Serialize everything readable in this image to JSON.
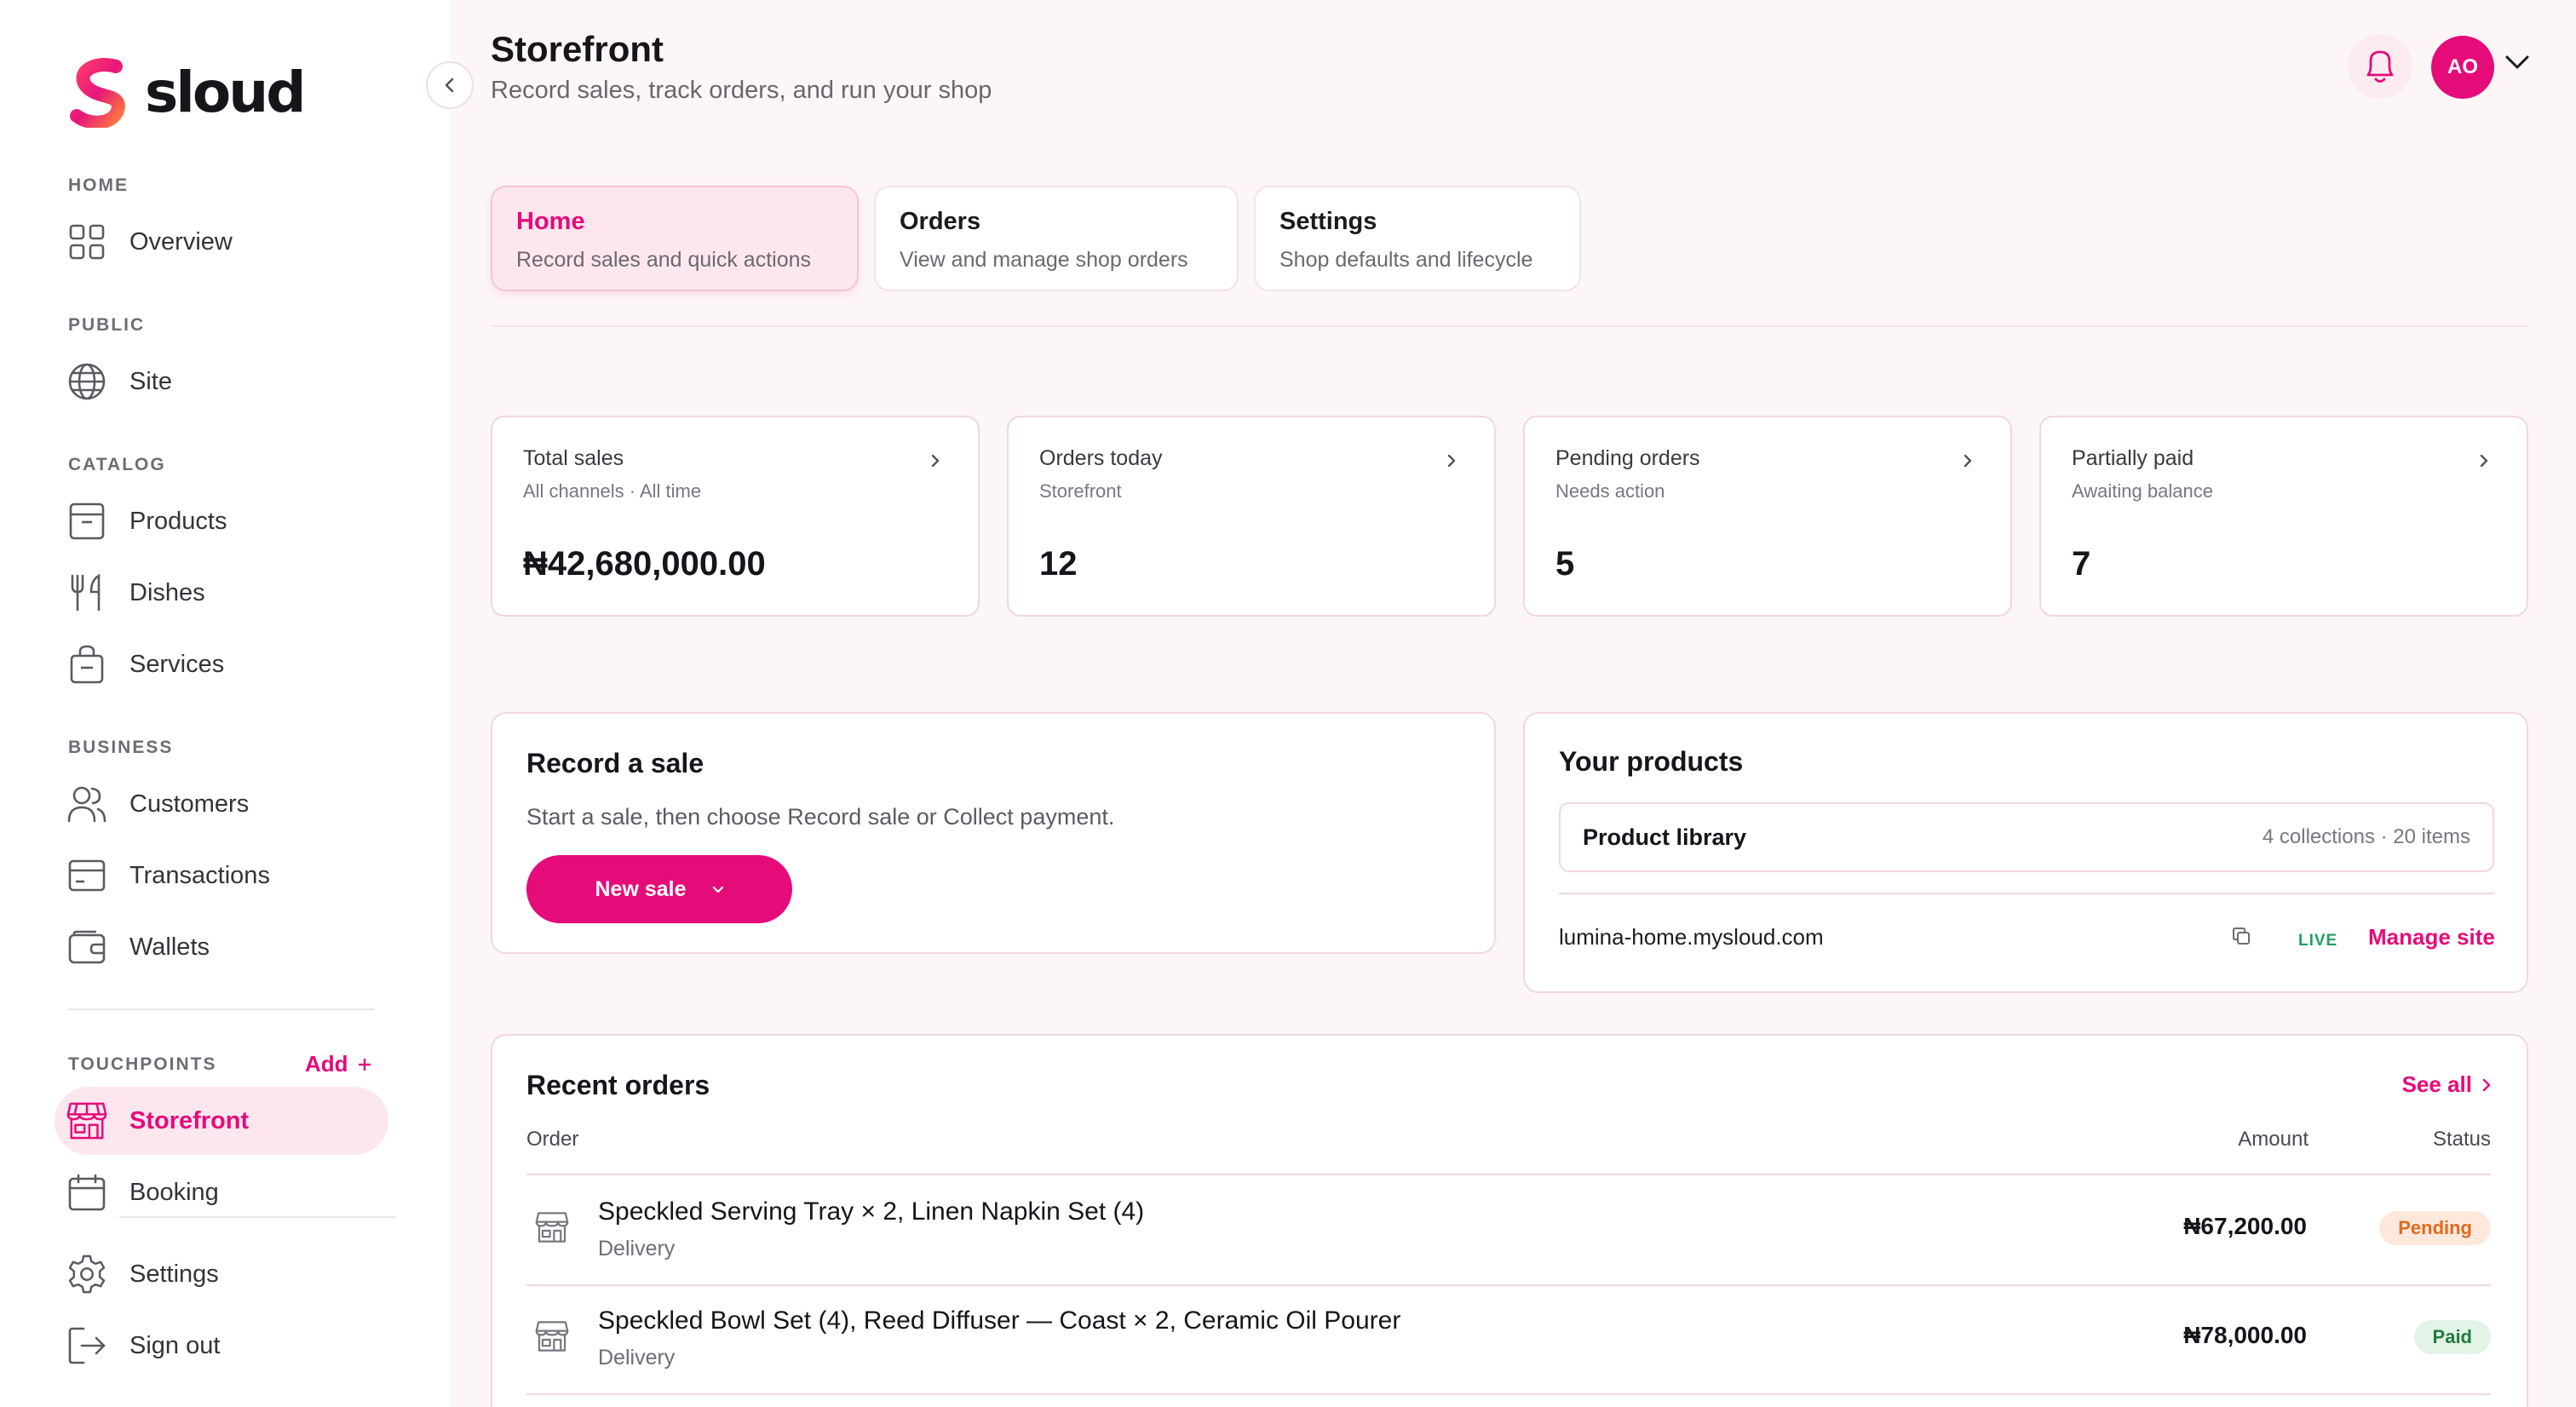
{
  "brand": {
    "name": "sloud",
    "accent": "#e50b79"
  },
  "sidebar": {
    "sections": {
      "home": "HOME",
      "public": "PUBLIC",
      "catalog": "CATALOG",
      "business": "BUSINESS",
      "touchpoints": "TOUCHPOINTS"
    },
    "items": {
      "overview": {
        "label": "Overview",
        "icon": "grid-icon"
      },
      "site": {
        "label": "Site",
        "icon": "globe-icon"
      },
      "products": {
        "label": "Products",
        "icon": "archive-box-icon"
      },
      "dishes": {
        "label": "Dishes",
        "icon": "fork-knife-icon"
      },
      "services": {
        "label": "Services",
        "icon": "bag-icon"
      },
      "customers": {
        "label": "Customers",
        "icon": "users-icon"
      },
      "transactions": {
        "label": "Transactions",
        "icon": "card-icon"
      },
      "wallets": {
        "label": "Wallets",
        "icon": "wallet-icon"
      },
      "storefront": {
        "label": "Storefront",
        "icon": "store-icon",
        "active": true
      },
      "booking": {
        "label": "Booking",
        "icon": "calendar-icon"
      }
    },
    "add_touchpoint": "Add",
    "footer": {
      "settings": {
        "label": "Settings",
        "icon": "gear-icon"
      },
      "sign_out": {
        "label": "Sign out",
        "icon": "sign-out-icon"
      }
    }
  },
  "header": {
    "title": "Storefront",
    "subtitle": "Record sales, track orders, and run your shop",
    "avatar_initials": "AO"
  },
  "tabs": [
    {
      "title": "Home",
      "subtitle": "Record sales and quick actions",
      "active": true
    },
    {
      "title": "Orders",
      "subtitle": "View and manage shop orders",
      "active": false
    },
    {
      "title": "Settings",
      "subtitle": "Shop defaults and lifecycle",
      "active": false
    }
  ],
  "stats": [
    {
      "title": "Total sales",
      "subtitle": "All channels · All time",
      "value": "₦42,680,000.00"
    },
    {
      "title": "Orders today",
      "subtitle": "Storefront",
      "value": "12"
    },
    {
      "title": "Pending orders",
      "subtitle": "Needs action",
      "value": "5"
    },
    {
      "title": "Partially paid",
      "subtitle": "Awaiting balance",
      "value": "7"
    }
  ],
  "record_sale": {
    "title": "Record a sale",
    "description": "Start a sale, then choose Record sale or Collect payment.",
    "button": "New sale"
  },
  "products": {
    "title": "Your products",
    "library_name": "Product library",
    "library_count": "4 collections · 20 items",
    "site_url": "lumina-home.mysloud.com",
    "live_label": "LIVE",
    "manage_label": "Manage site"
  },
  "recent_orders": {
    "title": "Recent orders",
    "see_all": "See all",
    "columns": {
      "order": "Order",
      "amount": "Amount",
      "status": "Status"
    },
    "rows": [
      {
        "name": "Speckled Serving Tray × 2, Linen Napkin Set (4)",
        "method": "Delivery",
        "amount": "₦67,200.00",
        "status": "Pending",
        "status_color": "#e06a1e"
      },
      {
        "name": "Speckled Bowl Set (4), Reed Diffuser — Coast × 2, Ceramic Oil Pourer",
        "method": "Delivery",
        "amount": "₦78,000.00",
        "status": "Paid",
        "status_color": "#237a3f"
      }
    ]
  }
}
